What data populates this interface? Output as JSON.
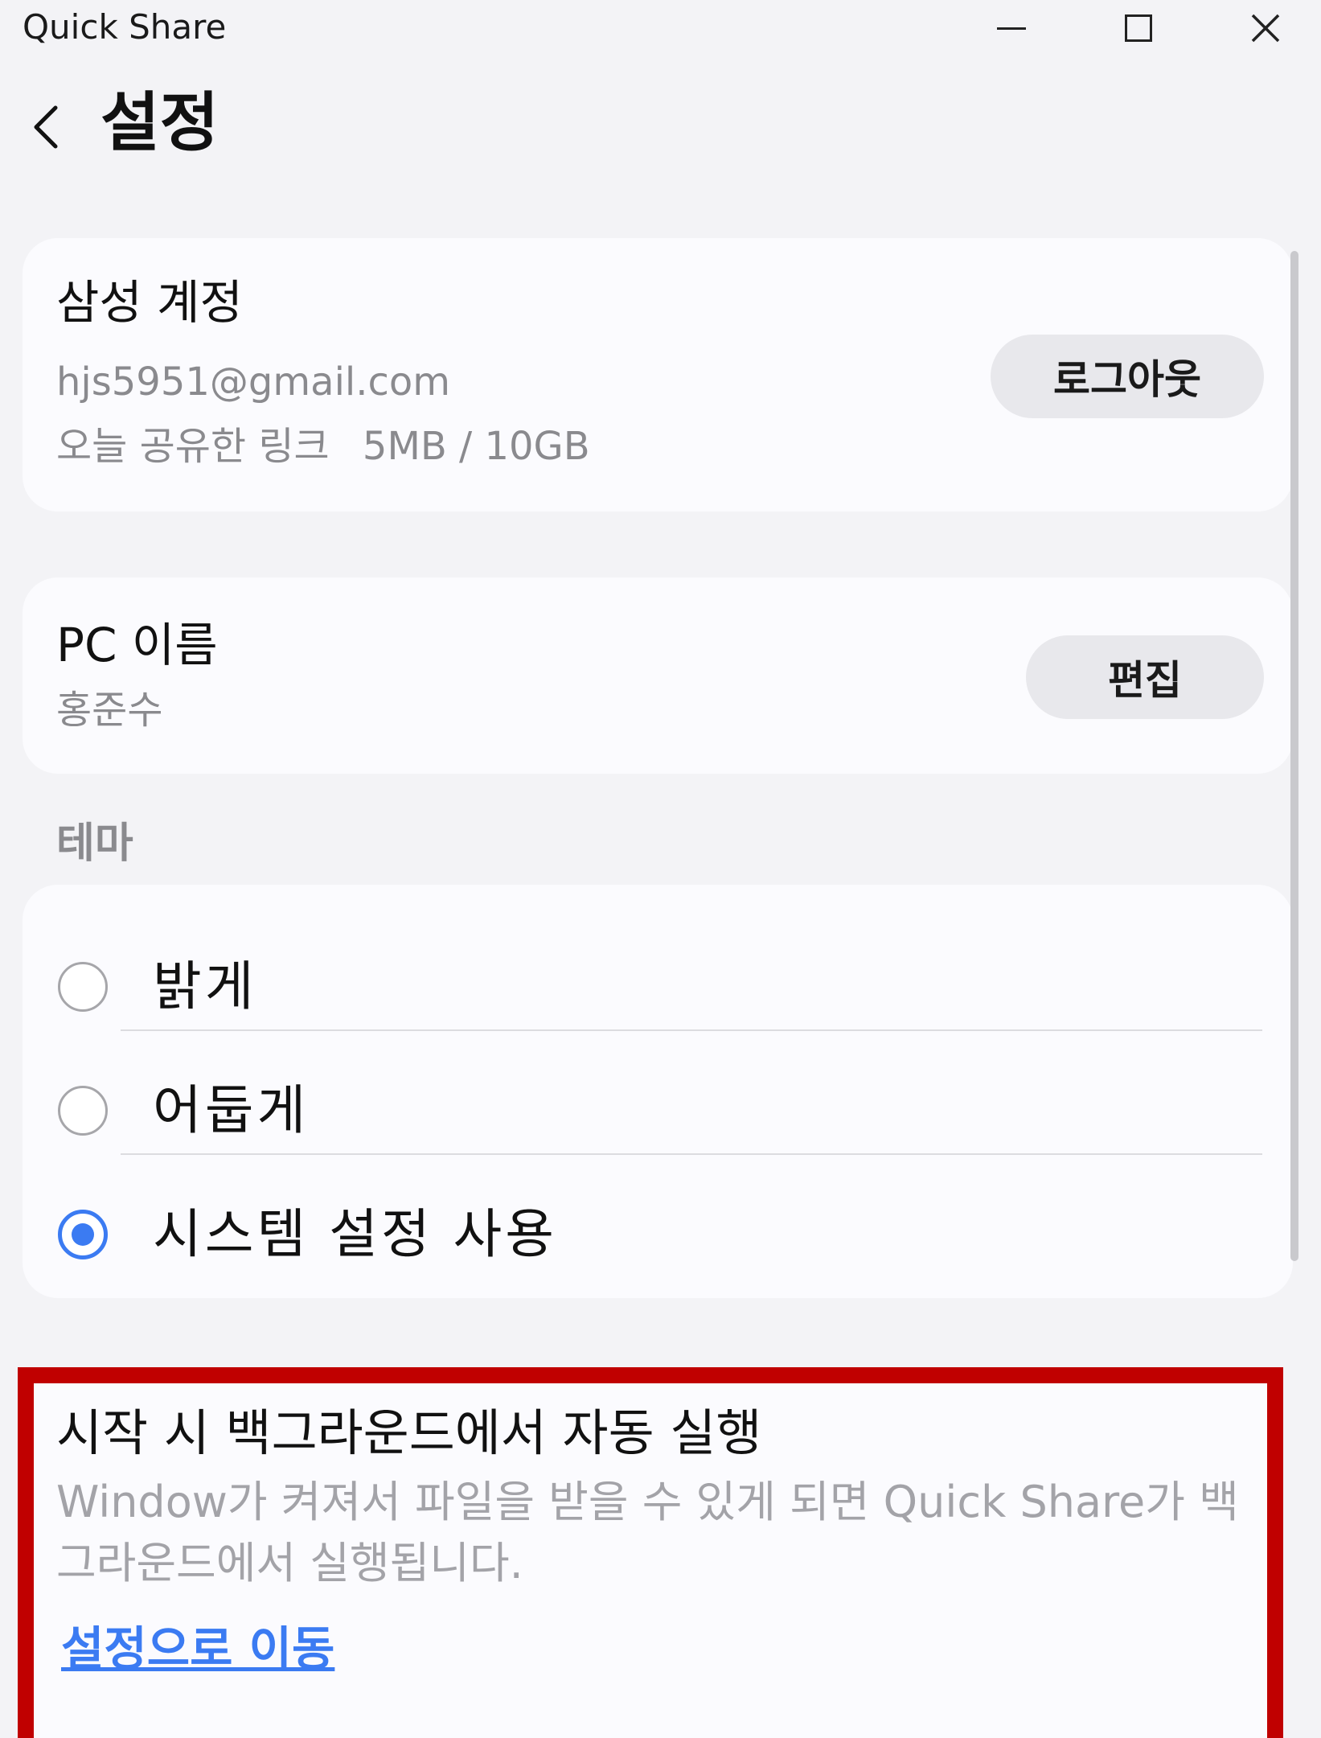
{
  "window": {
    "title": "Quick Share",
    "controls": [
      "minimize-icon",
      "maximize-icon",
      "close-icon"
    ]
  },
  "header": {
    "back_icon": "chevron-left-icon",
    "title": "설정"
  },
  "account": {
    "title": "삼성 계정",
    "email": "hjs5951@gmail.com",
    "usage_label": "오늘 공유한 링크",
    "usage_value": "5MB / 10GB",
    "logout_label": "로그아웃"
  },
  "pc_name": {
    "title": "PC 이름",
    "value": "홍준수",
    "edit_label": "편집"
  },
  "theme": {
    "section_label": "테마",
    "options": [
      {
        "label": "밝게",
        "selected": false
      },
      {
        "label": "어둡게",
        "selected": false
      },
      {
        "label": "시스템 설정 사용",
        "selected": true
      }
    ]
  },
  "autostart": {
    "title": "시작 시 백그라운드에서 자동 실행",
    "description": "Window가 켜져서 파일을 받을 수 있게 되면 Quick Share가 백그라운드에서 실행됩니다.",
    "link_label": "설정으로 이동"
  },
  "colors": {
    "accent": "#3b7bf2",
    "highlight_border": "#c00000",
    "background": "#f3f3f6",
    "card": "#fbfbfe",
    "secondary_text": "#8a8a8e"
  }
}
